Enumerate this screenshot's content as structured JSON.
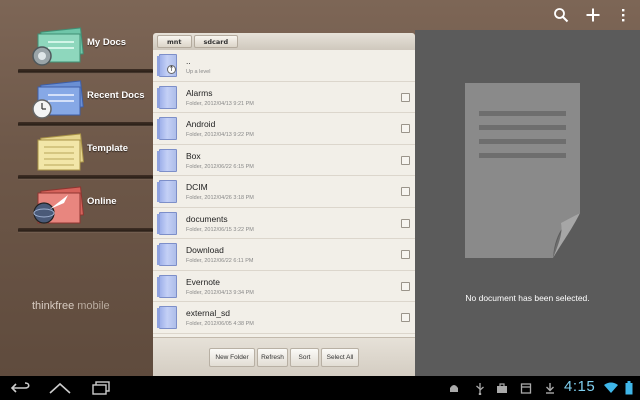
{
  "topbar": {
    "actions": [
      {
        "icon": "search-icon"
      },
      {
        "icon": "plus-icon"
      },
      {
        "icon": "overflow-menu-icon"
      }
    ]
  },
  "nav": {
    "items": [
      {
        "label": "My Docs",
        "active": true,
        "icon": "my-docs-icon"
      },
      {
        "label": "Recent Docs",
        "active": false,
        "icon": "recent-docs-icon"
      },
      {
        "label": "Template",
        "active": false,
        "icon": "template-icon"
      },
      {
        "label": "Online",
        "active": false,
        "icon": "online-icon"
      }
    ],
    "brand_primary": "thinkfree",
    "brand_secondary": " mobile"
  },
  "breadcrumb": [
    "mnt",
    "sdcard"
  ],
  "files": [
    {
      "name": "..",
      "meta": "Up a level",
      "up": true
    },
    {
      "name": "Alarms",
      "meta": "Folder, 2012/04/13 9:21 PM"
    },
    {
      "name": "Android",
      "meta": "Folder, 2012/04/13 9:22 PM"
    },
    {
      "name": "Box",
      "meta": "Folder, 2012/06/22 6:15 PM"
    },
    {
      "name": "DCIM",
      "meta": "Folder, 2012/04/26 3:18 PM"
    },
    {
      "name": "documents",
      "meta": "Folder, 2012/06/15 3:22 PM"
    },
    {
      "name": "Download",
      "meta": "Folder, 2012/06/22 6:11 PM"
    },
    {
      "name": "Evernote",
      "meta": "Folder, 2012/04/13 9:34 PM"
    },
    {
      "name": "external_sd",
      "meta": "Folder, 2012/06/05 4:38 PM"
    }
  ],
  "toolbar": {
    "new_folder": "New Folder",
    "refresh": "Refresh",
    "sort": "Sort",
    "select_all": "Select All"
  },
  "preview": {
    "empty_message": "No document has been selected."
  },
  "systembar": {
    "time": "4:15",
    "clock_color": "#7fcfef"
  }
}
